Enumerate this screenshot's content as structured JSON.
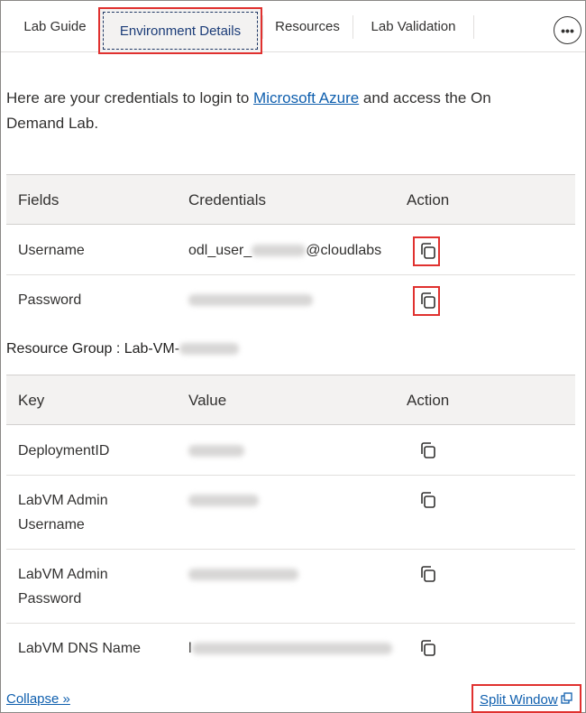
{
  "tabs": [
    {
      "label": "Lab Guide"
    },
    {
      "label": "Environment Details",
      "active": true
    },
    {
      "label": "Resources"
    },
    {
      "label": "Lab Validation"
    }
  ],
  "more_button": {
    "icon": "ellipsis-icon",
    "label": "•••"
  },
  "intro": {
    "text_before": "Here are your credentials to login to ",
    "link": "Microsoft Azure",
    "text_after": " and access the On Demand Lab."
  },
  "credentials_table": {
    "headers": [
      "Fields",
      "Credentials",
      "Action"
    ],
    "rows": [
      {
        "field": "Username",
        "value_prefix": "odl_user_",
        "value_suffix": "@cloudlabs",
        "action_icon": "copy-icon"
      },
      {
        "field": "Password",
        "value_prefix": "",
        "value_suffix": "",
        "action_icon": "copy-icon"
      }
    ]
  },
  "resource_group": {
    "label": "Resource Group : Lab-VM-"
  },
  "resource_table": {
    "headers": [
      "Key",
      "Value",
      "Action"
    ],
    "rows": [
      {
        "key": "DeploymentID",
        "action_icon": "copy-icon"
      },
      {
        "key": "LabVM Admin Username",
        "action_icon": "copy-icon"
      },
      {
        "key": "LabVM Admin Password",
        "action_icon": "copy-icon"
      },
      {
        "key": "LabVM DNS Name",
        "value_prefix": "l",
        "action_icon": "copy-icon"
      }
    ]
  },
  "footer": {
    "collapse_label": "Collapse »",
    "split_label": "Split Window",
    "split_icon": "popout-icon"
  },
  "colors": {
    "highlight": "#e0312f",
    "link": "#0f5fae",
    "active_tab_text": "#1b3c78",
    "header_bg": "#f3f2f1"
  }
}
